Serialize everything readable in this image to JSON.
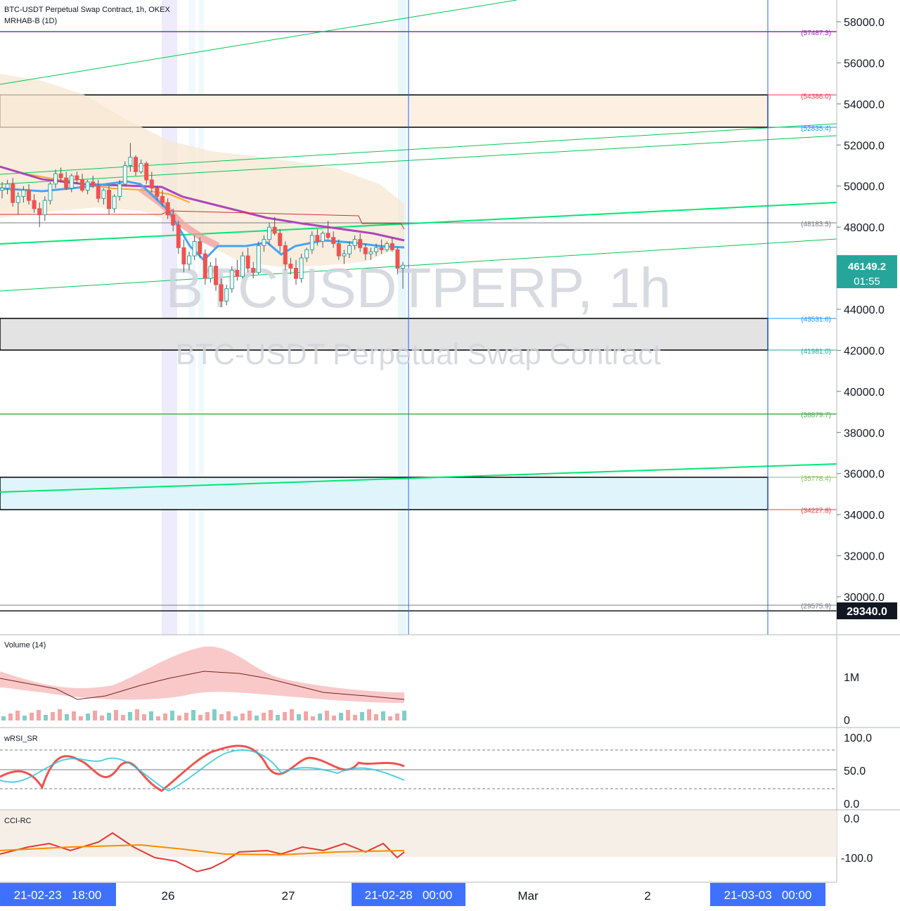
{
  "header": {
    "title": "BTC-USDT Perpetual Swap Contract, 1h, OKEX",
    "indicator": "MRHAB-B (1D)"
  },
  "watermark": {
    "symbol": "BTCUSDTPERP, 1h",
    "description": "BTC-USDT Perpetual Swap Contract"
  },
  "price_badge": {
    "price": "46149.2",
    "countdown": "01:55",
    "color": "#26a69a"
  },
  "crosshair_price": "29340.0",
  "time_labels": {
    "cursor1": "21-02-23   18:00",
    "cursor2": "21-02-28   00:00",
    "cursor3": "21-03-03   00:00",
    "ticks": [
      "26",
      "27",
      "Mar",
      "2"
    ]
  },
  "panes": {
    "volume": {
      "label": "Volume (14)",
      "ticks": [
        "1M",
        "0"
      ]
    },
    "wrsi": {
      "label": "wRSI_SR",
      "ticks": [
        "100.0",
        "50.0",
        "0.0"
      ]
    },
    "cci": {
      "label": "CCI-RC",
      "ticks": [
        "0.0",
        "-100.0"
      ]
    }
  },
  "level_labels": {
    "l57487": "(57487.3)",
    "l54386": "(54386.0)",
    "l52835": "(52835.4)",
    "l48183": "(48183.5)",
    "l43531": "(43531.6)",
    "l41981": "(41981.0)",
    "l38879": "(38879.7)",
    "l35778": "(35778.4)",
    "l34227": "(34227.8)",
    "l29575": "(29575.9)"
  },
  "chart_data": {
    "type": "candlestick",
    "symbol": "BTC-USDT Perpetual Swap Contract",
    "interval": "1h",
    "exchange": "OKEX",
    "y_axis_ticks": [
      58000,
      56000,
      54000,
      52000,
      50000,
      48000,
      46000,
      44000,
      42000,
      40000,
      38000,
      36000,
      34000,
      32000,
      30000
    ],
    "y_axis_range": [
      29000,
      59000
    ],
    "levels": [
      {
        "value": 57487.3,
        "color": "#9c27b0"
      },
      {
        "value": 54386.0,
        "color": "#f23645"
      },
      {
        "value": 52835.4,
        "color": "#2196f3"
      },
      {
        "value": 48183.5,
        "color": "#787b86"
      },
      {
        "value": 43531.6,
        "color": "#2196f3"
      },
      {
        "value": 41981.0,
        "color": "#26a69a"
      },
      {
        "value": 38879.7,
        "color": "#4caf50"
      },
      {
        "value": 35778.4,
        "color": "#8bc34a"
      },
      {
        "value": 34227.8,
        "color": "#f23645"
      },
      {
        "value": 29575.9,
        "color": "#787b86"
      }
    ],
    "zones": [
      {
        "from": 52835.4,
        "to": 54386.0,
        "color": "#fdf0e3"
      },
      {
        "from": 41981.0,
        "to": 43531.6,
        "color": "#e3e3e3"
      },
      {
        "from": 34227.8,
        "to": 35778.4,
        "color": "#e0f5fb"
      }
    ],
    "ohlc": [
      [
        49800,
        50200,
        49400,
        49900
      ],
      [
        49900,
        50300,
        49600,
        50100
      ],
      [
        50100,
        50400,
        49000,
        49200
      ],
      [
        49200,
        49700,
        48600,
        49500
      ],
      [
        49500,
        50000,
        49200,
        49800
      ],
      [
        49800,
        50100,
        49100,
        49300
      ],
      [
        49300,
        49600,
        48700,
        48900
      ],
      [
        48900,
        49200,
        48000,
        48600
      ],
      [
        48600,
        49500,
        48300,
        49300
      ],
      [
        49300,
        50200,
        49100,
        50100
      ],
      [
        50100,
        50800,
        49900,
        50600
      ],
      [
        50600,
        50900,
        50200,
        50400
      ],
      [
        50400,
        50700,
        49800,
        49900
      ],
      [
        49900,
        50600,
        49700,
        50500
      ],
      [
        50500,
        50700,
        50100,
        50300
      ],
      [
        50300,
        50600,
        49700,
        49800
      ],
      [
        49800,
        50300,
        49600,
        50200
      ],
      [
        50200,
        50500,
        49900,
        50000
      ],
      [
        50000,
        50300,
        49200,
        49400
      ],
      [
        49400,
        49900,
        49100,
        49800
      ],
      [
        49800,
        50000,
        48600,
        48900
      ],
      [
        48900,
        49600,
        48700,
        49500
      ],
      [
        49500,
        50300,
        49300,
        50100
      ],
      [
        50100,
        51200,
        50000,
        51000
      ],
      [
        51000,
        52100,
        50700,
        51400
      ],
      [
        51400,
        51500,
        50500,
        50700
      ],
      [
        50700,
        51300,
        50600,
        51100
      ],
      [
        51100,
        51200,
        50100,
        50300
      ],
      [
        50300,
        50700,
        49700,
        49900
      ],
      [
        49900,
        50000,
        49300,
        49500
      ],
      [
        49500,
        49800,
        49000,
        49200
      ],
      [
        49200,
        49400,
        48400,
        48600
      ],
      [
        48600,
        48900,
        47800,
        48100
      ],
      [
        48100,
        48300,
        46700,
        47000
      ],
      [
        47000,
        47400,
        45800,
        46200
      ],
      [
        46200,
        46800,
        45900,
        46600
      ],
      [
        46600,
        47600,
        46400,
        47300
      ],
      [
        47300,
        47500,
        46500,
        46700
      ],
      [
        46700,
        46900,
        45200,
        45500
      ],
      [
        45500,
        46300,
        45300,
        46100
      ],
      [
        46100,
        46500,
        44900,
        45200
      ],
      [
        45200,
        45500,
        44100,
        44400
      ],
      [
        44400,
        45200,
        44200,
        45000
      ],
      [
        45000,
        46100,
        44800,
        45900
      ],
      [
        45900,
        46400,
        45400,
        45600
      ],
      [
        45600,
        46800,
        45500,
        46600
      ],
      [
        46600,
        47000,
        45800,
        46000
      ],
      [
        46000,
        46300,
        45500,
        45800
      ],
      [
        45800,
        47300,
        45700,
        47100
      ],
      [
        47100,
        47600,
        46800,
        47400
      ],
      [
        47400,
        48200,
        47100,
        48000
      ],
      [
        48000,
        48500,
        47600,
        47700
      ],
      [
        47700,
        47900,
        46800,
        47100
      ],
      [
        47100,
        47300,
        45900,
        46200
      ],
      [
        46200,
        46500,
        45700,
        46000
      ],
      [
        46000,
        46400,
        45200,
        45500
      ],
      [
        45500,
        46700,
        45300,
        46500
      ],
      [
        46500,
        47000,
        46300,
        46900
      ],
      [
        46900,
        47800,
        46700,
        47600
      ],
      [
        47600,
        47900,
        47100,
        47300
      ],
      [
        47300,
        47800,
        47000,
        47700
      ],
      [
        47700,
        48300,
        47400,
        47500
      ],
      [
        47500,
        47800,
        47000,
        47200
      ],
      [
        47200,
        47400,
        46400,
        46600
      ],
      [
        46600,
        46900,
        46200,
        46700
      ],
      [
        46700,
        47300,
        46500,
        47100
      ],
      [
        47100,
        47600,
        46900,
        47400
      ],
      [
        47400,
        47700,
        46800,
        47000
      ],
      [
        47000,
        47200,
        46400,
        46700
      ],
      [
        46700,
        47000,
        46400,
        46800
      ],
      [
        46800,
        47200,
        46600,
        47000
      ],
      [
        47000,
        47400,
        46700,
        46900
      ],
      [
        46900,
        47300,
        46800,
        47200
      ],
      [
        47200,
        47500,
        46800,
        46900
      ],
      [
        46900,
        47000,
        45700,
        46000
      ],
      [
        46000,
        46300,
        45000,
        46149
      ]
    ],
    "wrsi_range": [
      0,
      100
    ],
    "cci_range": [
      -150,
      25
    ],
    "volume_ticks": [
      "1M",
      "0"
    ]
  }
}
